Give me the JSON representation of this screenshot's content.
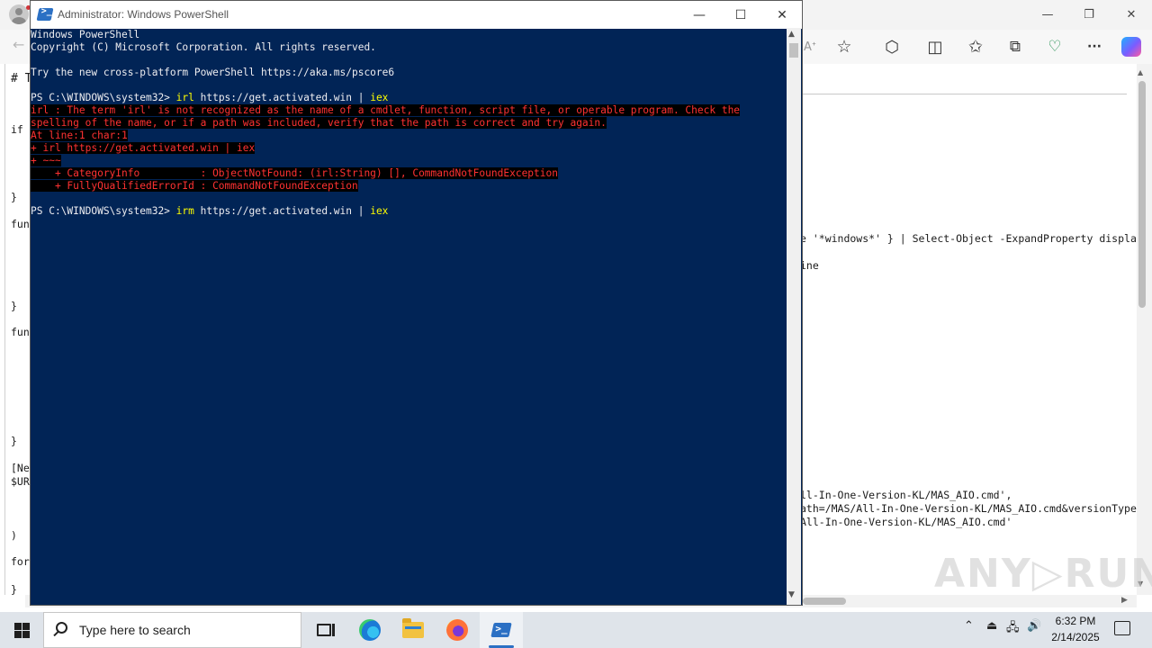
{
  "browser": {
    "window_controls": {
      "minimize": "—",
      "maximize": "❐",
      "close": "✕"
    },
    "toolbar_icons": [
      "read-aloud-icon",
      "favorite-star-icon",
      "extensions-icon",
      "split-screen-icon",
      "favorites-icon",
      "collections-icon",
      "browser-essentials-icon",
      "more-icon",
      "copilot-icon"
    ],
    "toolbar_glyphs": {
      "read_aloud": "Aᐩ",
      "star": "☆",
      "extensions": "⬡",
      "split": "◫",
      "favorites": "✩",
      "collections": "⧉",
      "essentials": "♡",
      "more": "···"
    },
    "back_glyph": "←",
    "left_code": [
      "# T",
      "if",
      "}",
      "fun",
      "}",
      "fun",
      "}",
      "[Ne",
      "$UR",
      ")",
      "for",
      "}"
    ],
    "right_code": {
      "line1": "e '*windows*' } | Select-Object -ExpandProperty displa",
      "line2": "ine",
      "line3": "ll-In-One-Version-KL/MAS_AIO.cmd',",
      "line4": "ath=/MAS/All-In-One-Version-KL/MAS_AIO.cmd&versionType",
      "line5": "All-In-One-Version-KL/MAS_AIO.cmd'"
    },
    "scroll_glyphs": {
      "up": "▲",
      "down": "▼",
      "right": "▶"
    }
  },
  "watermark": "ANY▷RUN",
  "powershell": {
    "title": "Administrator: Windows PowerShell",
    "window_controls": {
      "minimize": "—",
      "maximize": "☐",
      "close": "✕"
    },
    "lines": {
      "banner1": "Windows PowerShell",
      "banner2": "Copyright (C) Microsoft Corporation. All rights reserved.",
      "banner3": "Try the new cross-platform PowerShell https://aka.ms/pscore6",
      "prompt": "PS C:\\WINDOWS\\system32> ",
      "cmd1_name": "irl",
      "cmd_url": " https://get.activated.win | ",
      "cmd_iex": "iex",
      "err1": "irl : The term 'irl' is not recognized as the name of a cmdlet, function, script file, or operable program. Check the",
      "err2": "spelling of the name, or if a path was included, verify that the path is correct and try again.",
      "err3": "At line:1 char:1",
      "err4": "+ irl https://get.activated.win | iex",
      "err5": "+ ~~~",
      "err6": "    + CategoryInfo          : ObjectNotFound: (irl:String) [], CommandNotFoundException",
      "err7": "    + FullyQualifiedErrorId : CommandNotFoundException",
      "cmd2_name": "irm"
    },
    "scroll_glyphs": {
      "up": "▲",
      "down": "▼"
    }
  },
  "taskbar": {
    "search_placeholder": "Type here to search",
    "apps": [
      "task-view",
      "microsoft-edge",
      "file-explorer",
      "firefox",
      "windows-powershell"
    ],
    "tray": {
      "chevron": "⌃",
      "usb": "⏏",
      "network": "🖧",
      "volume": "🔊"
    },
    "time": "6:32 PM",
    "date": "2/14/2025"
  },
  "colors": {
    "ps_background": "#012456",
    "ps_error": "#ff3232",
    "ps_command": "#ffff00",
    "taskbar": "#dfe4ea"
  }
}
